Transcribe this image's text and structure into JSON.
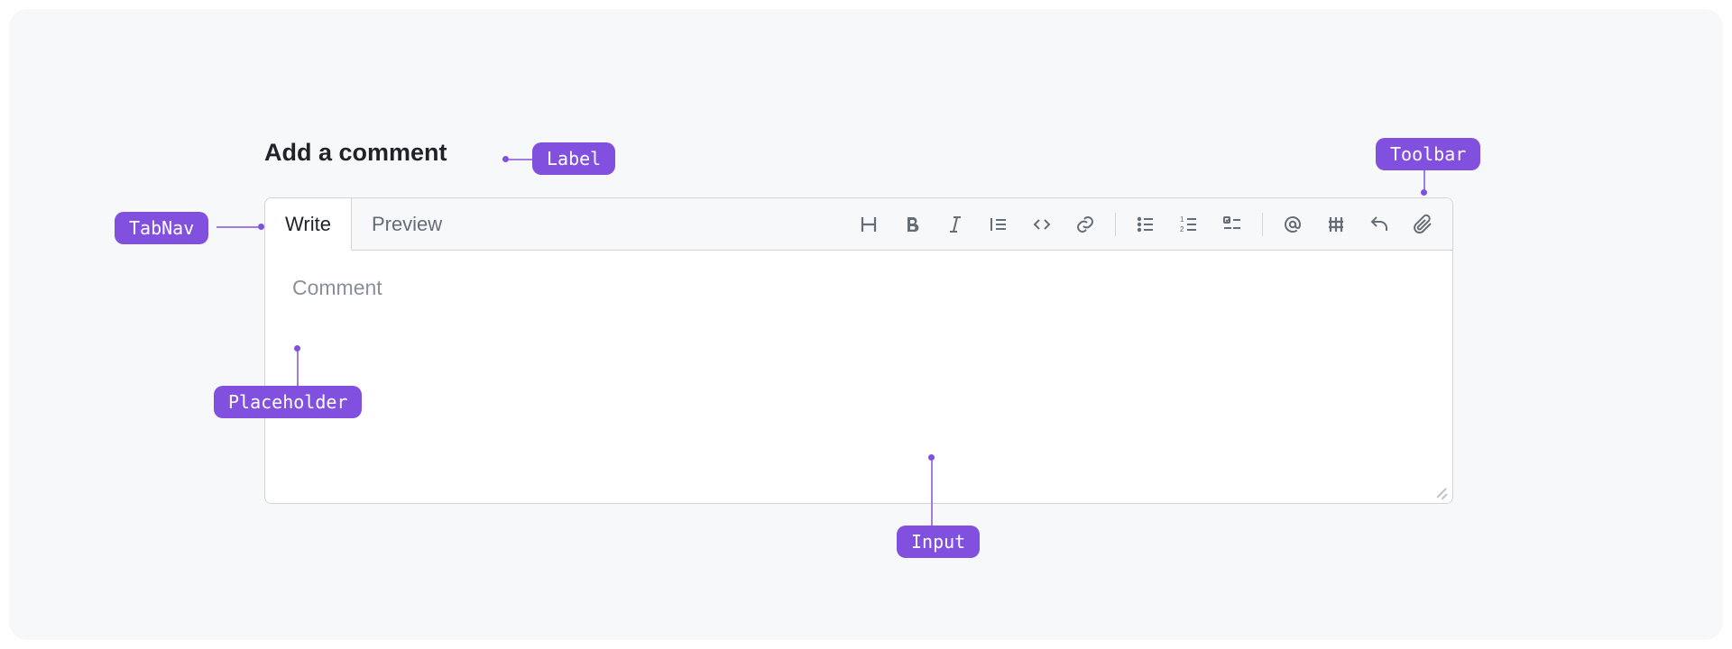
{
  "title": "Add a comment",
  "tabs": {
    "write": "Write",
    "preview": "Preview"
  },
  "textarea": {
    "placeholder": "Comment",
    "value": ""
  },
  "toolbar_icons": {
    "heading": "heading-icon",
    "bold": "bold-icon",
    "italic": "italic-icon",
    "quote": "quote-icon",
    "code": "code-icon",
    "link": "link-icon",
    "ul": "unordered-list-icon",
    "ol": "ordered-list-icon",
    "task": "task-list-icon",
    "mention": "mention-icon",
    "reference": "reference-icon",
    "reply": "reply-icon",
    "attach": "attach-icon"
  },
  "annotations": {
    "label": "Label",
    "toolbar": "Toolbar",
    "tabnav": "TabNav",
    "placeholder": "Placeholder",
    "input": "Input"
  },
  "colors": {
    "accent": "#8250df",
    "border": "#d1d5da",
    "muted": "#656d76"
  }
}
